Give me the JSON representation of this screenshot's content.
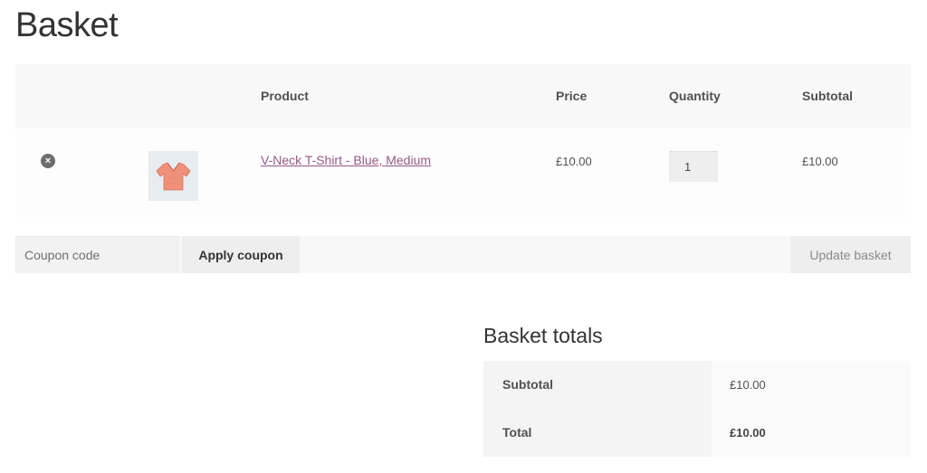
{
  "page": {
    "title": "Basket"
  },
  "cart": {
    "headers": {
      "product": "Product",
      "price": "Price",
      "quantity": "Quantity",
      "subtotal": "Subtotal"
    },
    "items": [
      {
        "remove_icon": "remove-circle-x-icon",
        "remove_glyph": "×",
        "thumbnail": "pink-vneck-tshirt",
        "name": "V-Neck T-Shirt - Blue, Medium",
        "price": "£10.00",
        "quantity": "1",
        "subtotal": "£10.00"
      }
    ]
  },
  "actions": {
    "coupon_placeholder": "Coupon code",
    "apply_coupon_label": "Apply coupon",
    "update_basket_label": "Update basket"
  },
  "totals": {
    "title": "Basket totals",
    "rows": [
      {
        "label": "Subtotal",
        "value": "£10.00"
      },
      {
        "label": "Total",
        "value": "£10.00"
      }
    ]
  },
  "colors": {
    "link": "#96588a",
    "header_bg": "#f8f8f8",
    "button_bg": "#eeeeee",
    "tshirt": "#f0907a"
  }
}
